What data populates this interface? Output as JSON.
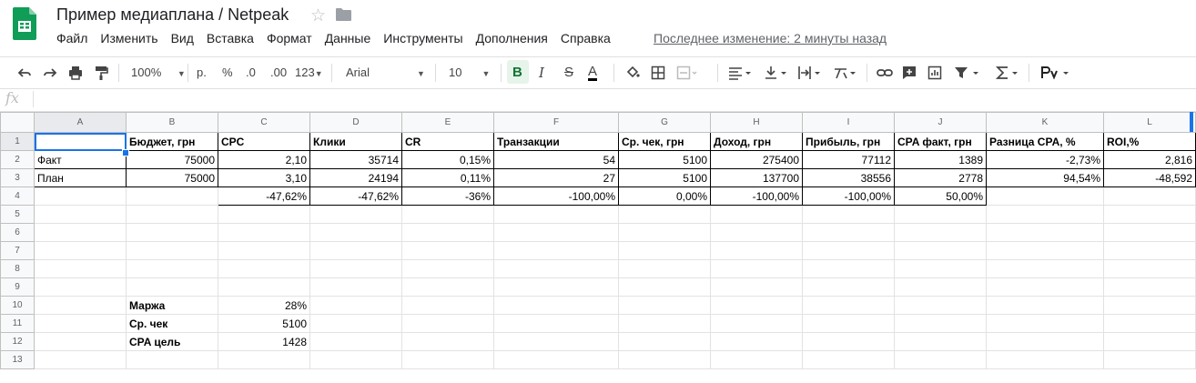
{
  "header": {
    "doc_title": "Пример медиаплана / Netpeak",
    "menus": [
      "Файл",
      "Изменить",
      "Вид",
      "Вставка",
      "Формат",
      "Данные",
      "Инструменты",
      "Дополнения",
      "Справка"
    ],
    "last_edit": "Последнее изменение: 2 минуты назад"
  },
  "toolbar": {
    "zoom": "100%",
    "currency": "р.",
    "percent": "%",
    "dec_less": ".0",
    "dec_more": ".00",
    "more_formats": "123",
    "font": "Arial",
    "font_size": "10",
    "bold": "B",
    "italic": "I",
    "strike": "S",
    "text_color": "A"
  },
  "formula_bar": {
    "fx": "fx",
    "value": ""
  },
  "colors": {
    "accent": "#1a73e8",
    "sheets_green": "#0f9d58",
    "header_bg": "#f8f9fa"
  },
  "sheet": {
    "columns": [
      "A",
      "B",
      "C",
      "D",
      "E",
      "F",
      "G",
      "H",
      "I",
      "J",
      "K",
      "L"
    ],
    "rows": [
      {
        "n": "1",
        "cells": [
          "",
          "Бюджет, грн",
          "CPC",
          "Клики",
          "CR",
          "Транзакции",
          "Ср. чек, грн",
          "Доход, грн",
          "Прибыль, грн",
          "CPA факт, грн",
          "Разница CPA, %",
          "ROI,%"
        ]
      },
      {
        "n": "2",
        "cells": [
          "Факт",
          "75000",
          "2,10",
          "35714",
          "0,15%",
          "54",
          "5100",
          "275400",
          "77112",
          "1389",
          "-2,73%",
          "2,816"
        ]
      },
      {
        "n": "3",
        "cells": [
          "План",
          "75000",
          "3,10",
          "24194",
          "0,11%",
          "27",
          "5100",
          "137700",
          "38556",
          "2778",
          "94,54%",
          "-48,592"
        ]
      },
      {
        "n": "4",
        "cells": [
          "",
          "",
          "-47,62%",
          "-47,62%",
          "-36%",
          "-100,00%",
          "0,00%",
          "-100,00%",
          "-100,00%",
          "50,00%",
          "",
          ""
        ]
      },
      {
        "n": "5",
        "cells": [
          "",
          "",
          "",
          "",
          "",
          "",
          "",
          "",
          "",
          "",
          "",
          ""
        ]
      },
      {
        "n": "6",
        "cells": [
          "",
          "",
          "",
          "",
          "",
          "",
          "",
          "",
          "",
          "",
          "",
          ""
        ]
      },
      {
        "n": "7",
        "cells": [
          "",
          "",
          "",
          "",
          "",
          "",
          "",
          "",
          "",
          "",
          "",
          ""
        ]
      },
      {
        "n": "8",
        "cells": [
          "",
          "",
          "",
          "",
          "",
          "",
          "",
          "",
          "",
          "",
          "",
          ""
        ]
      },
      {
        "n": "9",
        "cells": [
          "",
          "",
          "",
          "",
          "",
          "",
          "",
          "",
          "",
          "",
          "",
          ""
        ]
      },
      {
        "n": "10",
        "cells": [
          "",
          "Маржа",
          "28%",
          "",
          "",
          "",
          "",
          "",
          "",
          "",
          "",
          ""
        ]
      },
      {
        "n": "11",
        "cells": [
          "",
          "Ср. чек",
          "5100",
          "",
          "",
          "",
          "",
          "",
          "",
          "",
          "",
          ""
        ]
      },
      {
        "n": "12",
        "cells": [
          "",
          "CPA цель",
          "1428",
          "",
          "",
          "",
          "",
          "",
          "",
          "",
          "",
          ""
        ]
      },
      {
        "n": "13",
        "cells": [
          "",
          "",
          "",
          "",
          "",
          "",
          "",
          "",
          "",
          "",
          "",
          ""
        ]
      }
    ]
  }
}
